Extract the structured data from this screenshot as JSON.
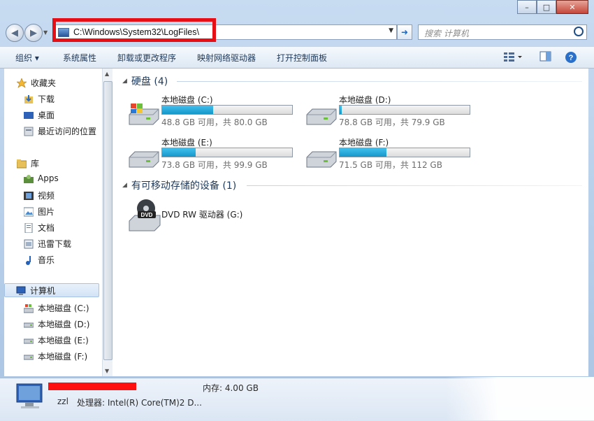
{
  "window": {
    "minimize_glyph": "–",
    "maximize_glyph": "□",
    "close_glyph": "✕"
  },
  "address": {
    "path": "C:\\Windows\\System32\\LogFiles\\",
    "search_placeholder": "搜索 计算机"
  },
  "toolbar": {
    "organize": "组织 ▾",
    "system_properties": "系统属性",
    "uninstall": "卸载或更改程序",
    "map_drive": "映射网络驱动器",
    "control_panel": "打开控制面板"
  },
  "sidebar": {
    "favorites": {
      "label": "收藏夹",
      "items": [
        "下载",
        "桌面",
        "最近访问的位置"
      ]
    },
    "libraries": {
      "label": "库",
      "items": [
        "Apps",
        "视频",
        "图片",
        "文档",
        "迅雷下载",
        "音乐"
      ]
    },
    "computer": {
      "label": "计算机",
      "items": [
        "本地磁盘 (C:)",
        "本地磁盘 (D:)",
        "本地磁盘 (E:)",
        "本地磁盘 (F:)"
      ]
    }
  },
  "content": {
    "hard_disks_header": "硬盘 (4)",
    "removable_header": "有可移动存储的设备 (1)",
    "drives": [
      {
        "name": "本地磁盘 (C:)",
        "free": "48.8 GB 可用，共 80.0 GB",
        "used_fraction": 0.39
      },
      {
        "name": "本地磁盘 (D:)",
        "free": "78.8 GB 可用，共 79.9 GB",
        "used_fraction": 0.014
      },
      {
        "name": "本地磁盘 (E:)",
        "free": "73.8 GB 可用，共 99.9 GB",
        "used_fraction": 0.26
      },
      {
        "name": "本地磁盘 (F:)",
        "free": "71.5 GB 可用，共 112 GB",
        "used_fraction": 0.36
      }
    ],
    "dvd": {
      "name": "DVD RW 驱动器 (G:)",
      "badge": "DVD"
    }
  },
  "details": {
    "computer_name": "zzl",
    "memory": "内存: 4.00 GB",
    "processor": "处理器: Intel(R) Core(TM)2 D..."
  },
  "colors": {
    "accent": "#1597c9",
    "highlight_box": "#e60f16",
    "redaction": "#ff1010"
  }
}
